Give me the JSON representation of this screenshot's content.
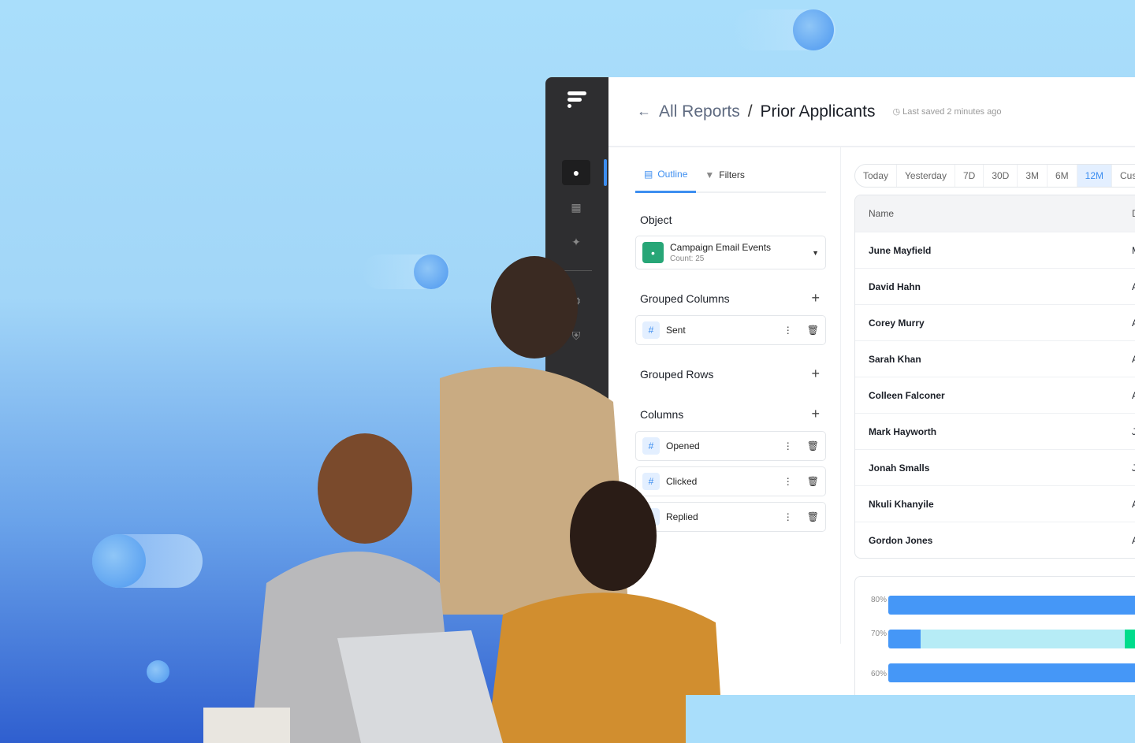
{
  "colors": {
    "accent": "#3d8ef0",
    "brand_green": "#27a677",
    "bar_blue": "#4597f7",
    "bar_light": "#b6ecf6",
    "bar_green": "#00dc8c"
  },
  "rail": {
    "icons": [
      "logo-icon",
      "user-search-icon",
      "chart-icon",
      "sparkles-icon",
      "settings-icon",
      "shield-icon"
    ]
  },
  "header": {
    "back_link": "All Reports",
    "separator": "/",
    "title": "Prior Applicants",
    "saved": "Last saved 2 minutes ago"
  },
  "left": {
    "tabs": [
      {
        "label": "Outline",
        "active": true
      },
      {
        "label": "Filters",
        "active": false
      }
    ],
    "object_label": "Object",
    "object": {
      "name": "Campaign Email Events",
      "count": "Count: 25"
    },
    "grouped_columns_label": "Grouped Columns",
    "grouped_columns": [
      "Sent"
    ],
    "grouped_rows_label": "Grouped Rows",
    "columns_label": "Columns",
    "columns": [
      "Opened",
      "Clicked",
      "Replied"
    ]
  },
  "range": {
    "options": [
      "Today",
      "Yesterday",
      "7D",
      "30D",
      "3M",
      "6M",
      "12M",
      "Cus"
    ],
    "selected": "12M"
  },
  "table": {
    "headers": [
      "Name",
      "D"
    ],
    "rows": [
      [
        "June Mayfield",
        "M"
      ],
      [
        "David Hahn",
        "A"
      ],
      [
        "Corey Murry",
        "A"
      ],
      [
        "Sarah Khan",
        "A"
      ],
      [
        "Colleen Falconer",
        "A"
      ],
      [
        "Mark Hayworth",
        "J"
      ],
      [
        "Jonah Smalls",
        "J"
      ],
      [
        "Nkuli Khanyile",
        "A"
      ],
      [
        "Gordon Jones",
        "A"
      ]
    ]
  },
  "chart_data": {
    "type": "bar",
    "orientation": "horizontal",
    "yticks": [
      "80%",
      "70%",
      "60%"
    ]
  }
}
